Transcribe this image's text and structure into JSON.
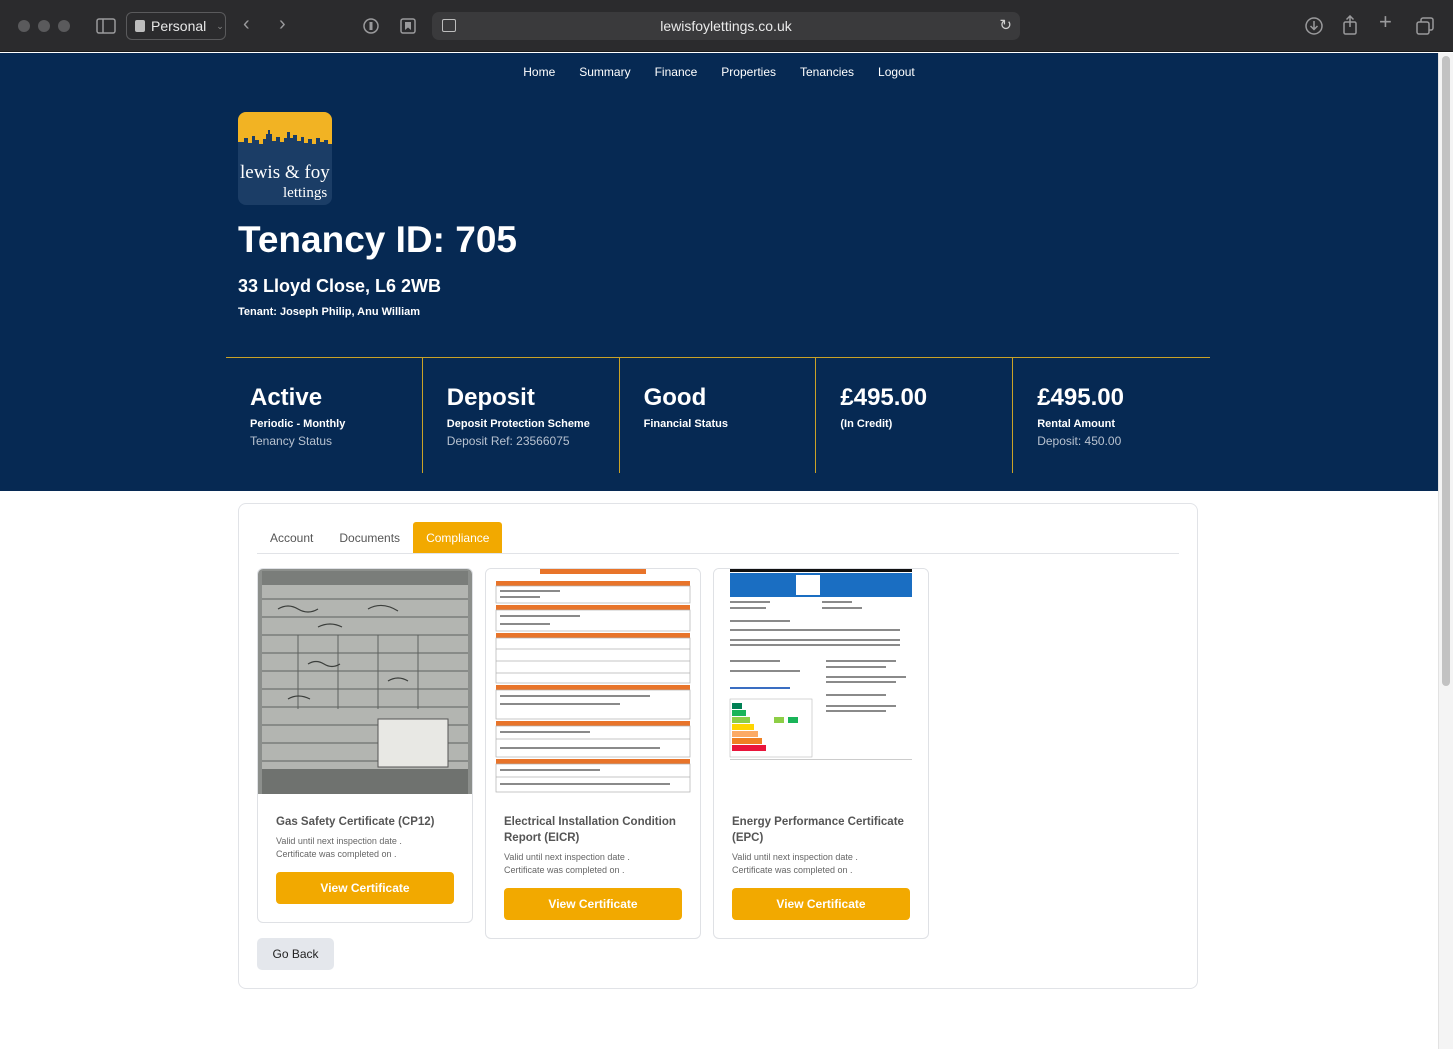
{
  "browser": {
    "profile": "Personal",
    "url": "lewisfoylettings.co.uk"
  },
  "nav": {
    "items": [
      "Home",
      "Summary",
      "Finance",
      "Properties",
      "Tenancies",
      "Logout"
    ]
  },
  "logo": {
    "line1": "lewis & foy",
    "line2": "lettings"
  },
  "header": {
    "title": "Tenancy ID: 705",
    "address": "33 Lloyd Close, L6 2WB",
    "tenant": "Tenant: Joseph Philip, Anu William"
  },
  "stats": [
    {
      "big": "Active",
      "sub": "Periodic - Monthly",
      "muted": "Tenancy Status"
    },
    {
      "big": "Deposit",
      "sub": "Deposit Protection Scheme",
      "muted": "Deposit Ref: 23566075"
    },
    {
      "big": "Good",
      "sub": "Financial Status",
      "muted": ""
    },
    {
      "big": "£495.00",
      "sub": "(In Credit)",
      "muted": ""
    },
    {
      "big": "£495.00",
      "sub": "Rental Amount",
      "muted": "Deposit: 450.00"
    }
  ],
  "tabs": {
    "account": "Account",
    "documents": "Documents",
    "compliance": "Compliance"
  },
  "certificates": [
    {
      "title": "Gas Safety Certificate (CP12)",
      "line1": "Valid until next inspection date .",
      "line2": "Certificate was completed on .",
      "button": "View Certificate",
      "thumb": "gas"
    },
    {
      "title": "Electrical Installation Condition Report (EICR)",
      "line1": "Valid until next inspection date .",
      "line2": "Certificate was completed on .",
      "button": "View Certificate",
      "thumb": "eicr"
    },
    {
      "title": "Energy Performance Certificate (EPC)",
      "line1": "Valid until next inspection date .",
      "line2": "Certificate was completed on .",
      "button": "View Certificate",
      "thumb": "epc"
    }
  ],
  "buttons": {
    "go_back": "Go Back"
  },
  "colors": {
    "navy": "#062953",
    "accent": "#f2a900",
    "divider": "#c9a227"
  }
}
